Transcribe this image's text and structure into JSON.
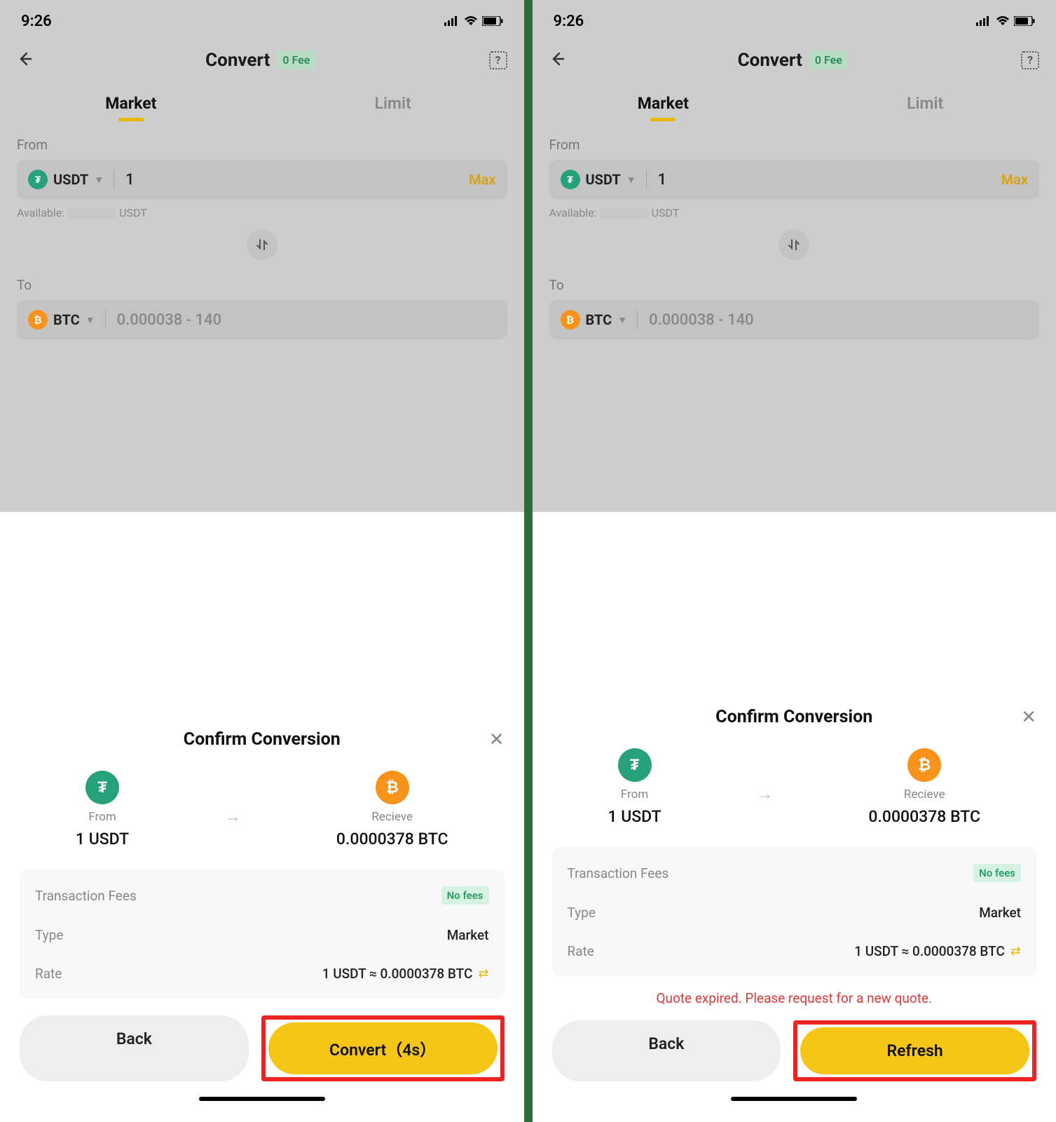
{
  "screens": [
    {
      "status": {
        "time": "9:26"
      },
      "header": {
        "title": "Convert",
        "fee_badge": "0 Fee"
      },
      "tabs": {
        "market": "Market",
        "limit": "Limit"
      },
      "from": {
        "label": "From",
        "coin": "USDT",
        "value": "1",
        "max": "Max",
        "available_prefix": "Available:",
        "available_suffix": "USDT"
      },
      "to": {
        "label": "To",
        "coin": "BTC",
        "placeholder": "0.000038 - 140"
      },
      "sheet": {
        "title": "Confirm Conversion",
        "from_label": "From",
        "from_amount": "1 USDT",
        "receive_label": "Recieve",
        "receive_amount": "0.0000378 BTC",
        "fees_label": "Transaction Fees",
        "fees_value": "No fees",
        "type_label": "Type",
        "type_value": "Market",
        "rate_label": "Rate",
        "rate_value": "1 USDT ≈ 0.0000378 BTC",
        "back_btn": "Back",
        "primary_btn": "Convert（4s）",
        "error": ""
      }
    },
    {
      "status": {
        "time": "9:26"
      },
      "header": {
        "title": "Convert",
        "fee_badge": "0 Fee"
      },
      "tabs": {
        "market": "Market",
        "limit": "Limit"
      },
      "from": {
        "label": "From",
        "coin": "USDT",
        "value": "1",
        "max": "Max",
        "available_prefix": "Available:",
        "available_suffix": "USDT"
      },
      "to": {
        "label": "To",
        "coin": "BTC",
        "placeholder": "0.000038 - 140"
      },
      "sheet": {
        "title": "Confirm Conversion",
        "from_label": "From",
        "from_amount": "1 USDT",
        "receive_label": "Recieve",
        "receive_amount": "0.0000378 BTC",
        "fees_label": "Transaction Fees",
        "fees_value": "No fees",
        "type_label": "Type",
        "type_value": "Market",
        "rate_label": "Rate",
        "rate_value": "1 USDT ≈ 0.0000378 BTC",
        "back_btn": "Back",
        "primary_btn": "Refresh",
        "error": "Quote expired. Please request for a new quote."
      }
    }
  ]
}
